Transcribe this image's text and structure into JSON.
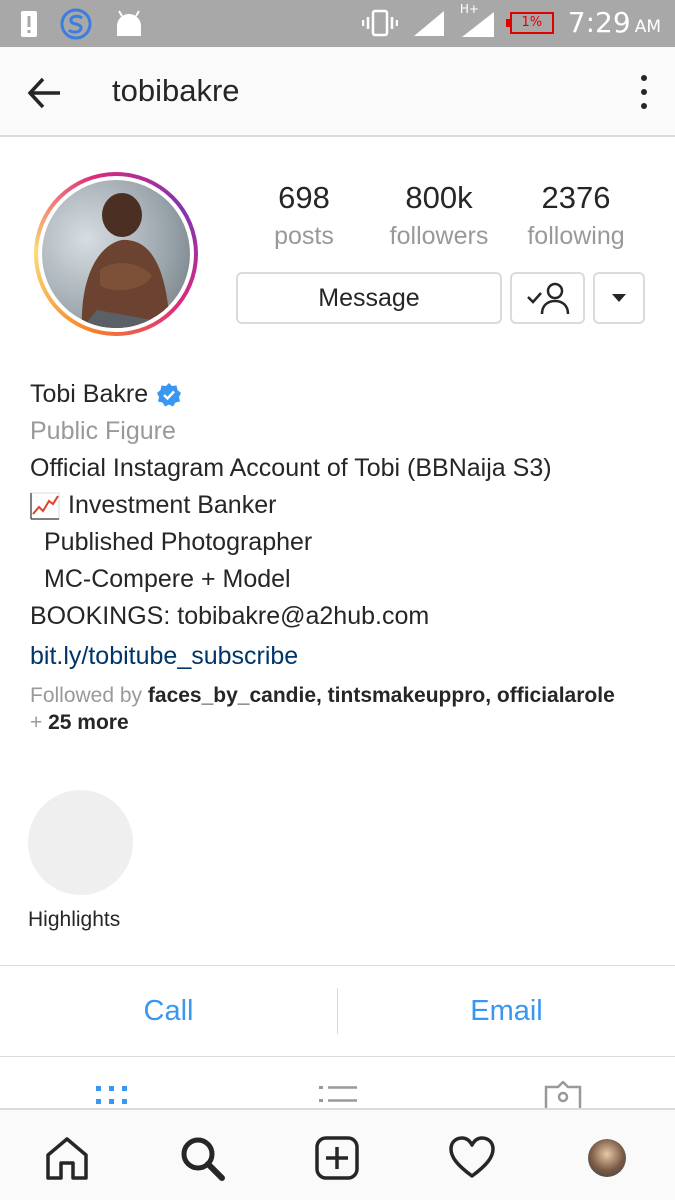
{
  "status_bar": {
    "time": "7:29",
    "ampm": "AM",
    "battery": "1%",
    "network": "H+"
  },
  "header": {
    "username": "tobibakre"
  },
  "stats": [
    {
      "value": "698",
      "label": "posts"
    },
    {
      "value": "800k",
      "label": "followers"
    },
    {
      "value": "2376",
      "label": "following"
    }
  ],
  "actions": {
    "message_label": "Message"
  },
  "bio": {
    "name": "Tobi Bakre",
    "category": "Public Figure",
    "line1": "Official Instagram Account of Tobi (BBNaija S3)",
    "line2": "Investment Banker",
    "line3": "Published Photographer",
    "line4": "MC-Compere + Model",
    "line5": "BOOKINGS: tobibakre@a2hub.com",
    "link": "bit.ly/tobitube_subscribe"
  },
  "followed_by": {
    "prefix": "Followed by ",
    "user1": "faces_by_candie",
    "sep1": ", ",
    "user2": "tintsmakeuppro",
    "sep2": ", ",
    "user3": "officialarole",
    "plus": "+ ",
    "more": "25 more"
  },
  "highlights": {
    "label": "Highlights"
  },
  "contact": {
    "call_label": "Call",
    "email_label": "Email"
  },
  "colors": {
    "link_blue": "#003569",
    "action_blue": "#3897f0",
    "verified_blue": "#3897f0",
    "muted_gray": "#999999",
    "battery_red": "#e00000"
  },
  "icons": {
    "back": "arrow-left-icon",
    "menu": "more-vertical-icon",
    "follow": "following-check-icon",
    "dropdown": "chevron-down-icon",
    "verified": "verified-badge-icon",
    "chart": "chart-increasing-icon",
    "home": "home-icon",
    "search": "search-icon",
    "add": "add-post-icon",
    "activity": "heart-icon",
    "grid": "grid-icon",
    "list": "list-icon",
    "tagged": "tagged-icon"
  }
}
